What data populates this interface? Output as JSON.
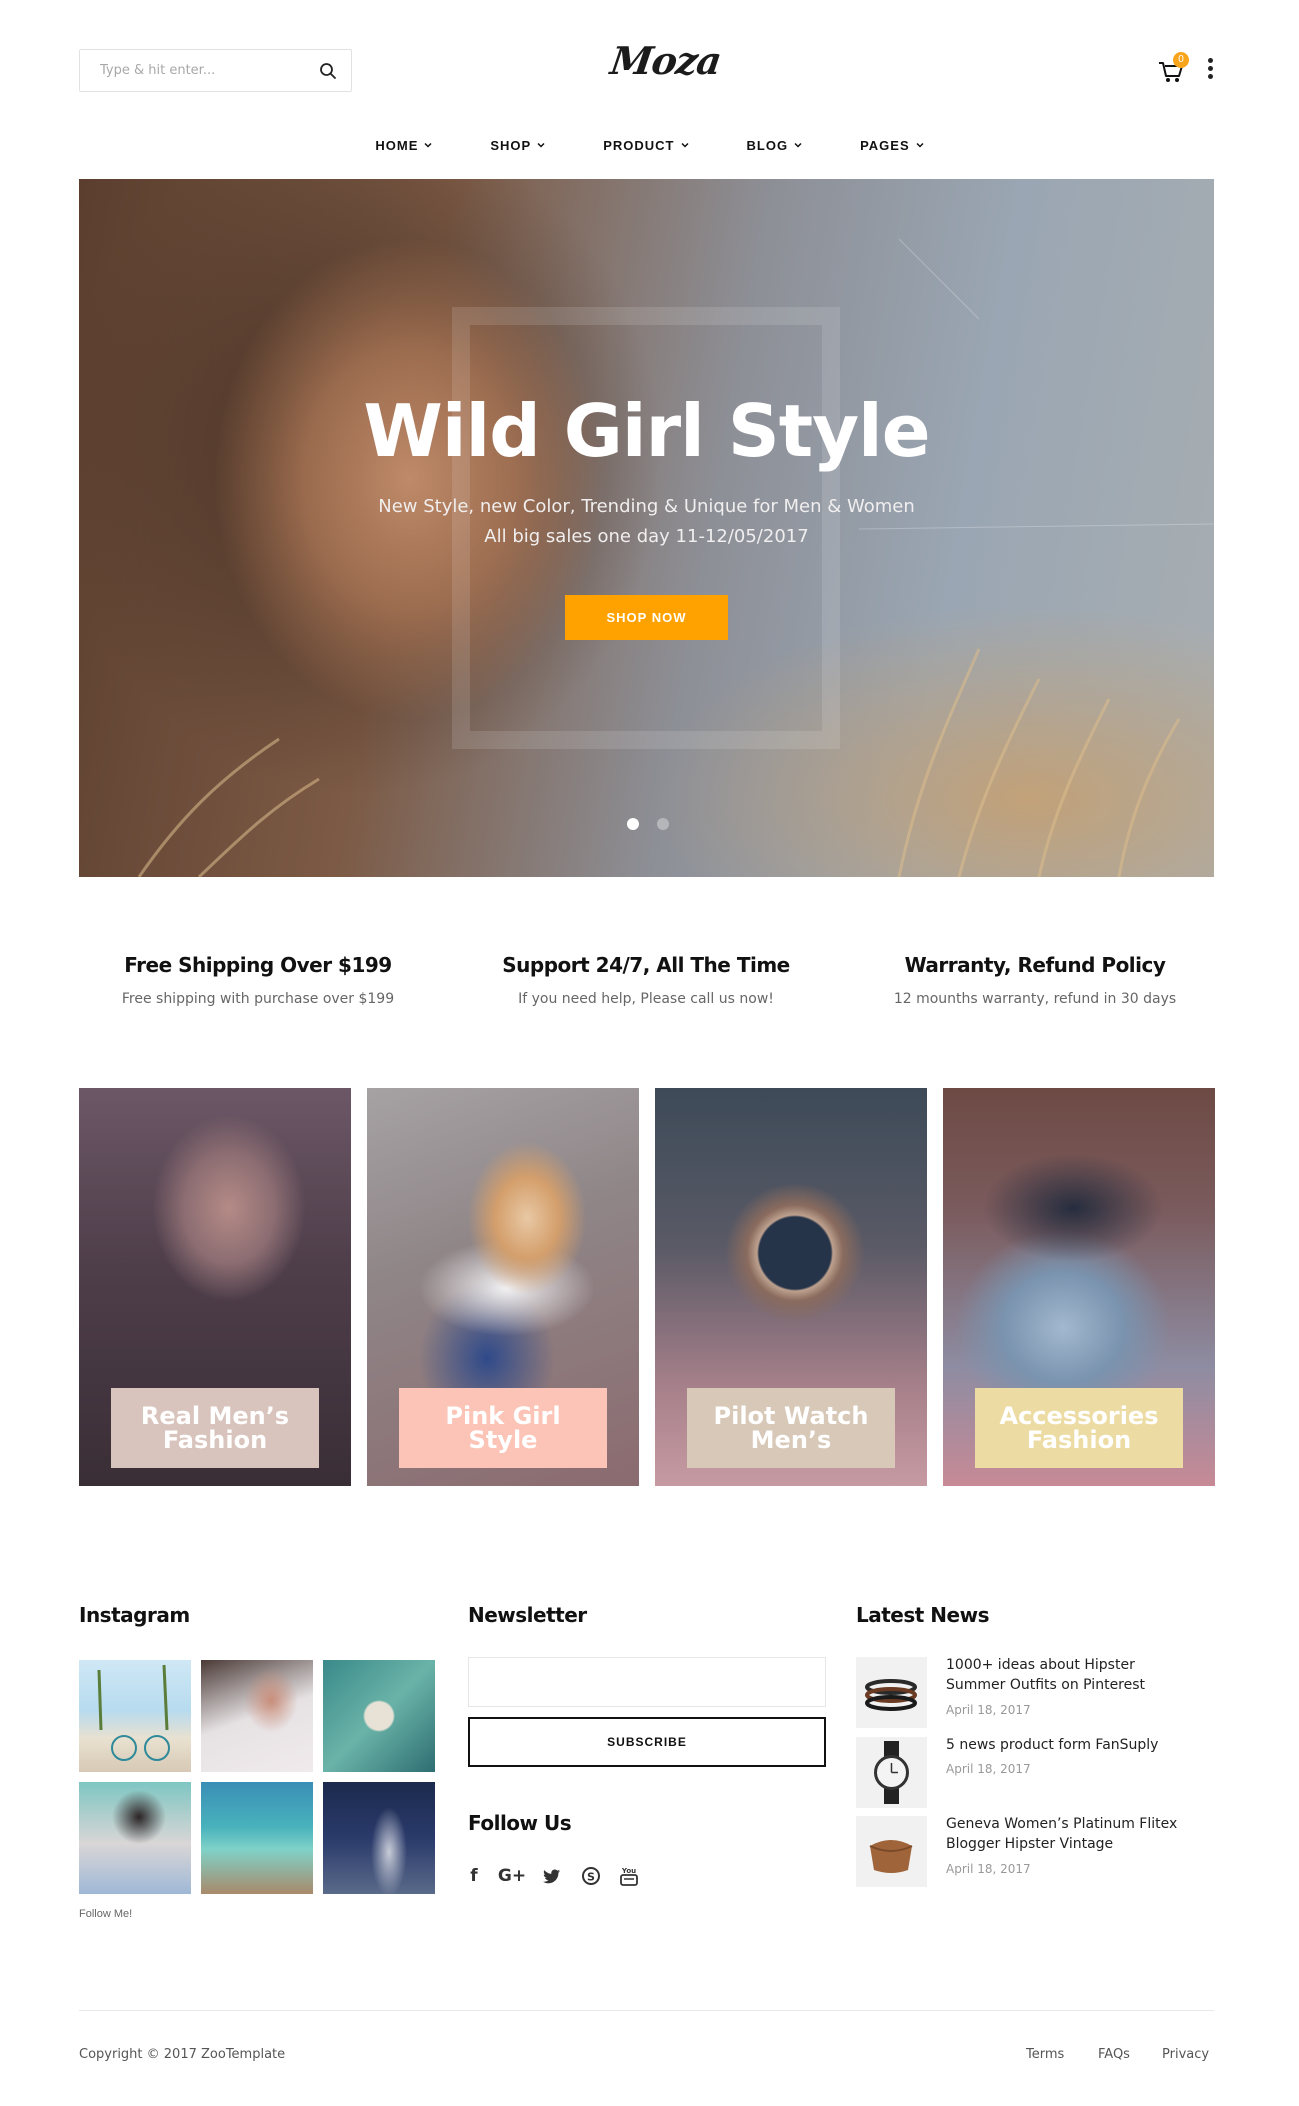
{
  "header": {
    "search_placeholder": "Type & hit enter...",
    "logo_text": "Moza",
    "cart_count": "0"
  },
  "nav": {
    "items": [
      {
        "label": "HOME"
      },
      {
        "label": "SHOP"
      },
      {
        "label": "PRODUCT"
      },
      {
        "label": "BLOG"
      },
      {
        "label": "PAGES"
      }
    ]
  },
  "hero": {
    "title": "Wild Girl Style",
    "subtitle_line1": "New Style, new Color, Trending & Unique for Men & Women",
    "subtitle_line2": "All big sales one day 11-12/05/2017",
    "button_label": "SHOP NOW",
    "slides": 2,
    "active_slide": 1
  },
  "features": [
    {
      "title": "Free Shipping Over $199",
      "text": "Free shipping with purchase over $199"
    },
    {
      "title": "Support 24/7, All The Time",
      "text": "If you need help, Please call us now!"
    },
    {
      "title": "Warranty, Refund Policy",
      "text": "12 mounths warranty, refund in 30 days"
    }
  ],
  "categories": [
    {
      "label": "Real Men’s Fashion",
      "label_color": "#d8c4bc"
    },
    {
      "label": "Pink Girl Style",
      "label_color": "#fbc4b6"
    },
    {
      "label": "Pilot Watch Men’s",
      "label_color": "#d8c8b8"
    },
    {
      "label": "Accessories Fashion",
      "label_color": "#ecdca4"
    }
  ],
  "instagram": {
    "title": "Instagram",
    "follow_label": "Follow Me!"
  },
  "newsletter": {
    "title": "Newsletter",
    "subscribe_label": "SUBSCRIBE",
    "follow_title": "Follow Us",
    "social_icons": [
      "facebook-icon",
      "google-plus-icon",
      "twitter-icon",
      "skype-icon",
      "youtube-icon"
    ]
  },
  "latest_news": {
    "title": "Latest News",
    "items": [
      {
        "title": "1000+ ideas about Hipster Summer Outfits on Pinterest",
        "date": "April 18, 2017"
      },
      {
        "title": "5 news product form FanSuply",
        "date": "April 18, 2017"
      },
      {
        "title": "Geneva Women’s Platinum Flitex Blogger Hipster Vintage",
        "date": "April 18, 2017"
      }
    ]
  },
  "footer": {
    "copyright": "Copyright © 2017 ZooTemplate",
    "links": [
      "Terms",
      "FAQs",
      "Privacy"
    ]
  },
  "colors": {
    "accent": "#ffa200",
    "badge": "#f8a51b"
  }
}
